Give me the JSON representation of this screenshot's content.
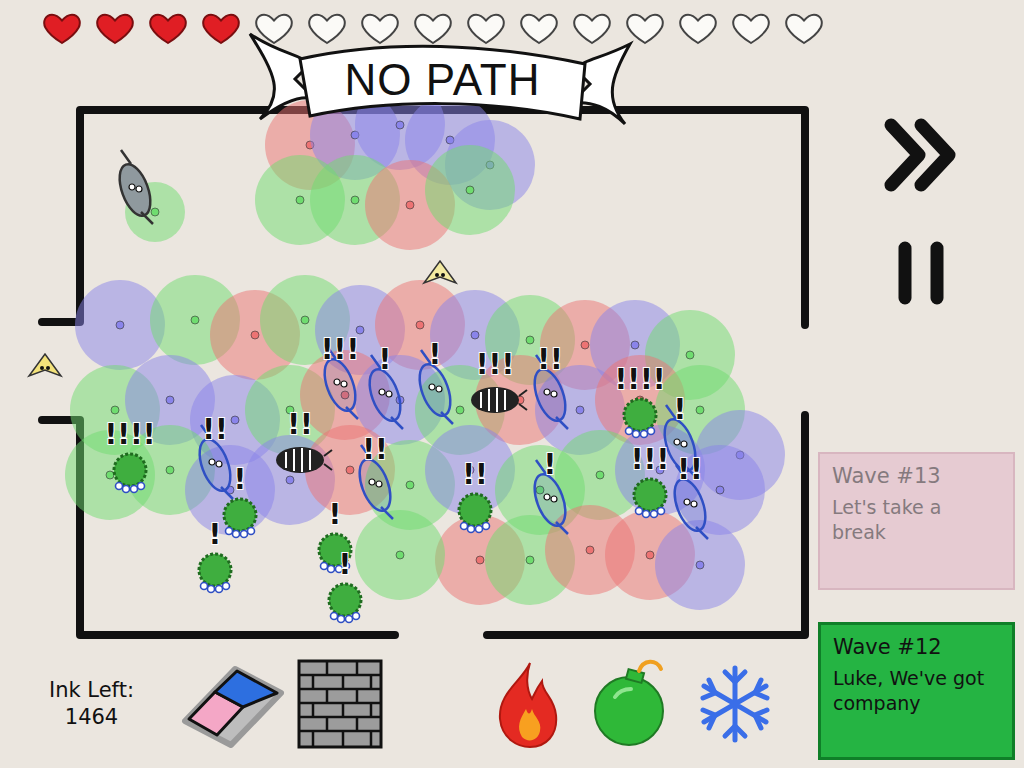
{
  "hearts": [
    {
      "filled": true
    },
    {
      "filled": true
    },
    {
      "filled": true
    },
    {
      "filled": true
    },
    {
      "filled": false
    },
    {
      "filled": false
    },
    {
      "filled": false
    },
    {
      "filled": false
    },
    {
      "filled": false
    },
    {
      "filled": false
    },
    {
      "filled": false
    },
    {
      "filled": false
    },
    {
      "filled": false
    },
    {
      "filled": false
    },
    {
      "filled": false
    }
  ],
  "banner": {
    "text": "NO PATH"
  },
  "towers": [
    {
      "kind": "fire",
      "color": "#ec7373"
    },
    {
      "kind": "ice",
      "color": "#8a84ea"
    },
    {
      "kind": "ice",
      "color": "#8a84ea"
    },
    {
      "kind": "ice",
      "color": "#8a84ea"
    },
    {
      "kind": "ice",
      "color": "#8a84ea"
    },
    {
      "kind": "bomb",
      "color": "#6fdc6f"
    },
    {
      "kind": "bomb",
      "color": "#6fdc6f"
    },
    {
      "kind": "fire",
      "color": "#ec7373"
    },
    {
      "kind": "bomb",
      "color": "#6fdc6f"
    },
    {
      "kind": "bomb",
      "color": "#6fdc6f"
    },
    {
      "kind": "ice",
      "color": "#8a84ea"
    },
    {
      "kind": "bomb",
      "color": "#6fdc6f"
    },
    {
      "kind": "fire",
      "color": "#ec7373"
    },
    {
      "kind": "bomb",
      "color": "#6fdc6f"
    },
    {
      "kind": "ice",
      "color": "#8a84ea"
    },
    {
      "kind": "fire",
      "color": "#ec7373"
    },
    {
      "kind": "ice",
      "color": "#8a84ea"
    },
    {
      "kind": "bomb",
      "color": "#6fdc6f"
    },
    {
      "kind": "fire",
      "color": "#ec7373"
    },
    {
      "kind": "ice",
      "color": "#8a84ea"
    },
    {
      "kind": "bomb",
      "color": "#6fdc6f"
    },
    {
      "kind": "bomb",
      "color": "#6fdc6f"
    },
    {
      "kind": "ice",
      "color": "#8a84ea"
    },
    {
      "kind": "ice",
      "color": "#8a84ea"
    },
    {
      "kind": "bomb",
      "color": "#6fdc6f"
    },
    {
      "kind": "fire",
      "color": "#ec7373"
    },
    {
      "kind": "ice",
      "color": "#8a84ea"
    },
    {
      "kind": "bomb",
      "color": "#6fdc6f"
    },
    {
      "kind": "fire",
      "color": "#ec7373"
    },
    {
      "kind": "ice",
      "color": "#8a84ea"
    },
    {
      "kind": "fire",
      "color": "#ec7373"
    },
    {
      "kind": "bomb",
      "color": "#6fdc6f"
    },
    {
      "kind": "ice",
      "color": "#8a84ea"
    },
    {
      "kind": "bomb",
      "color": "#6fdc6f"
    },
    {
      "kind": "bomb",
      "color": "#6fdc6f"
    },
    {
      "kind": "ice",
      "color": "#8a84ea"
    },
    {
      "kind": "ice",
      "color": "#8a84ea"
    },
    {
      "kind": "fire",
      "color": "#ec7373"
    },
    {
      "kind": "bomb",
      "color": "#6fdc6f"
    },
    {
      "kind": "ice",
      "color": "#8a84ea"
    },
    {
      "kind": "bomb",
      "color": "#6fdc6f"
    },
    {
      "kind": "bomb",
      "color": "#6fdc6f"
    },
    {
      "kind": "ice",
      "color": "#8a84ea"
    },
    {
      "kind": "ice",
      "color": "#8a84ea"
    },
    {
      "kind": "fire",
      "color": "#ec7373"
    },
    {
      "kind": "bomb",
      "color": "#6fdc6f"
    },
    {
      "kind": "fire",
      "color": "#ec7373"
    },
    {
      "kind": "fire",
      "color": "#ec7373"
    },
    {
      "kind": "ice",
      "color": "#8a84ea"
    },
    {
      "kind": "bomb",
      "color": "#6fdc6f"
    }
  ],
  "enemies": [
    {
      "kind": "bird",
      "color": "#8f999e"
    },
    {
      "kind": "fly",
      "color": "#f3eaa0"
    },
    {
      "kind": "fly",
      "color": "#f3e27a"
    },
    {
      "kind": "bird",
      "color": "#2f4fc4",
      "alert": "!!!"
    },
    {
      "kind": "bird",
      "color": "#2f4fc4",
      "alert": "!"
    },
    {
      "kind": "bird",
      "color": "#2f4fc4",
      "alert": "!"
    },
    {
      "kind": "beetle",
      "color": "#222222",
      "alert": "!!!"
    },
    {
      "kind": "bird",
      "color": "#2f4fc4",
      "alert": "!!"
    },
    {
      "kind": "bug",
      "color": "#3fae3f",
      "alert": "!!!!"
    },
    {
      "kind": "bird",
      "color": "#2f4fc4",
      "alert": "!"
    },
    {
      "kind": "bug",
      "color": "#3fae3f",
      "alert": "!!!!"
    },
    {
      "kind": "bird",
      "color": "#2f4fc4",
      "alert": "!!"
    },
    {
      "kind": "beetle",
      "color": "#222222",
      "alert": "!!"
    },
    {
      "kind": "bird",
      "color": "#2f4fc4",
      "alert": "!!"
    },
    {
      "kind": "bug",
      "color": "#3fae3f",
      "alert": "!!"
    },
    {
      "kind": "bird",
      "color": "#2f4fc4",
      "alert": "!"
    },
    {
      "kind": "bug",
      "color": "#3fae3f",
      "alert": "!!!"
    },
    {
      "kind": "bug",
      "color": "#3fae3f",
      "alert": "!"
    },
    {
      "kind": "bug",
      "color": "#3fae3f",
      "alert": "!"
    },
    {
      "kind": "bug",
      "color": "#3fae3f",
      "alert": "!"
    },
    {
      "kind": "bug",
      "color": "#3fae3f",
      "alert": "!"
    },
    {
      "kind": "bird",
      "color": "#2f4fc4",
      "alert": "!!"
    }
  ],
  "ink": {
    "label": "Ink Left:",
    "value": "1464"
  },
  "tools": [
    {
      "kind": "eraser",
      "selected": true
    },
    {
      "kind": "wall",
      "selected": false
    },
    {
      "kind": "fire",
      "selected": false
    },
    {
      "kind": "bomb",
      "selected": false
    },
    {
      "kind": "ice",
      "selected": false
    }
  ],
  "waves": [
    {
      "title": "Wave #13",
      "message": "Let's take a break",
      "active": false
    },
    {
      "title": "Wave #12",
      "message": "Luke, We've got company",
      "active": true
    }
  ]
}
